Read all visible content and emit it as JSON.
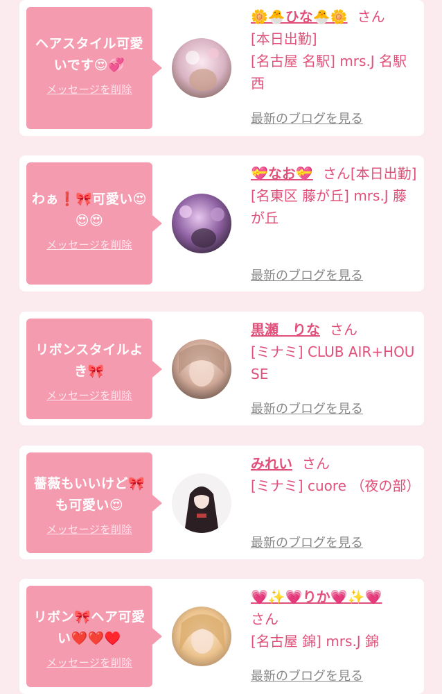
{
  "cards": [
    {
      "message": "ヘアスタイル可愛いです😍💞",
      "delete_label": "メッセージを削除",
      "name": "🌼🐣ひな🐣🌼",
      "honorific": "さん",
      "status": "[本日出勤]",
      "location": "[名古屋 名駅] mrs.J 名駅西",
      "blog_label": "最新のブログを見る",
      "avatar_colors": [
        "#f4d6e2",
        "#c9a7b6",
        "#8e6f66"
      ]
    },
    {
      "message": "わぁ❗️🎀可愛い😍😍😍",
      "delete_label": "メッセージを削除",
      "name": "💝なお💝",
      "honorific": "さん",
      "status": "[本日出勤]",
      "location": "[名東区 藤が丘] mrs.J 藤が丘",
      "blog_label": "最新のブログを見る",
      "avatar_colors": [
        "#d8b3e6",
        "#7a4f8a",
        "#3a2a3f"
      ]
    },
    {
      "message": "リボンスタイルよき🎀",
      "delete_label": "メッセージを削除",
      "name": "黒瀬　りな",
      "honorific": "さん",
      "status": "",
      "location": "[ミナミ] CLUB AIR+HOUSE",
      "blog_label": "最新のブログを見る",
      "avatar_colors": [
        "#f1d8cc",
        "#c8a292",
        "#6b5249"
      ]
    },
    {
      "message": "薔薇もいいけど🎀も可愛い😍",
      "delete_label": "メッセージを削除",
      "name": "みれい",
      "honorific": "さん",
      "status": "",
      "location": "[ミナミ] cuore （夜の部）",
      "blog_label": "最新のブログを見る",
      "avatar_colors": [
        "#f3f1f1",
        "#2b1f24",
        "#b9403e"
      ]
    },
    {
      "message": "リボン🎀ヘア可愛い❤️❤️♥️",
      "delete_label": "メッセージを削除",
      "name": "💗✨💗りか💗✨💗",
      "honorific": "さん",
      "status": "",
      "location": "[名古屋 錦] mrs.J 錦",
      "blog_label": "最新のブログを見る",
      "avatar_colors": [
        "#f6e2c8",
        "#e8b878",
        "#9c7a5c"
      ]
    }
  ]
}
